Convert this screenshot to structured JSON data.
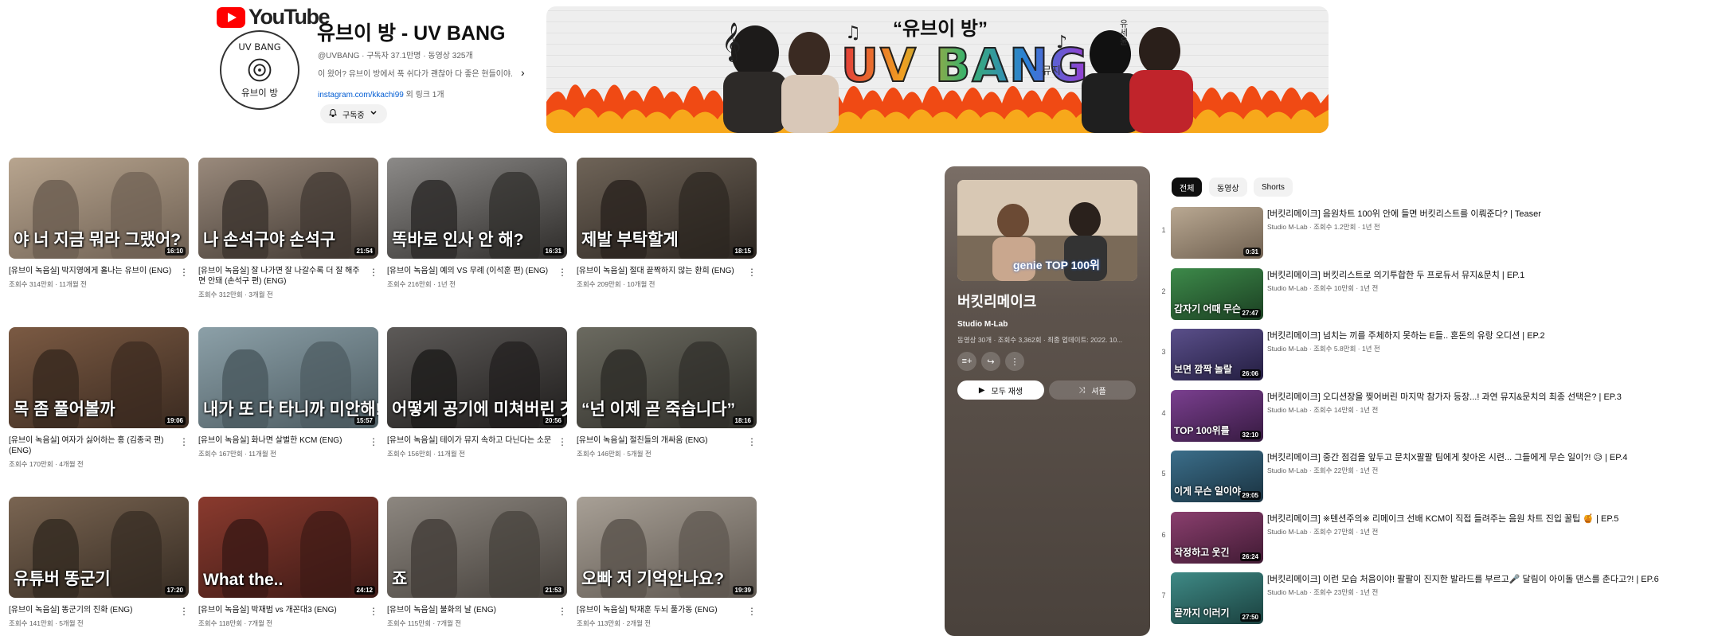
{
  "logo": {
    "wordmark": "YouTube"
  },
  "channel": {
    "avatar_text": "UV BANG 유브이 방",
    "title": "유브이 방 - UV BANG",
    "meta": "@UVBANG · 구독자 37.1만명 · 동영상 325개",
    "description": "이 왔어? 유브이 방에서 푹 쉬다가 괜찮아 다 좋은 현들이야.",
    "link_text": "instagram.com/kkachi99",
    "link_extra": " 외 링크 1개",
    "subscribe_label": "구독중"
  },
  "banner": {
    "subtitle": "“유브이 방”",
    "title": "UV BANG",
    "tag1": "뮤지",
    "tag2": "유세윤"
  },
  "videos": [
    {
      "caption": "야 너 지금 뭐라 그랬어?",
      "duration": "16:10",
      "title": "[유브이 녹음실] 박지영에게 홀나는 유브이 (ENG)",
      "meta": "조회수 314만회 · 11개월 전",
      "bg": "#b8a58f",
      "bg2": "#6d5f52"
    },
    {
      "caption": "나 손석구야 손석구",
      "duration": "21:54",
      "title": "[유브이 녹음실] 잘 나가면 잘 나갈수록 더 잘 해주면 안돼 (손석구 편) (ENG)",
      "meta": "조회수 312만회 · 3개월 전",
      "bg": "#9a8a7c",
      "bg2": "#3e3630"
    },
    {
      "caption": "똑바로 인사 안 해?",
      "duration": "16:31",
      "title": "[유브이 녹음실] 예의 VS 무례 (이석훈 편) (ENG)",
      "meta": "조회수 216만회 · 1년 전",
      "bg": "#8c8a88",
      "bg2": "#2e2c2a"
    },
    {
      "caption": "제발 부탁할게",
      "duration": "18:15",
      "title": "[유브이 녹음실] 절대 끝짝하지 않는 환희 (ENG)",
      "meta": "조회수 209만회 · 10개월 전",
      "bg": "#6f6458",
      "bg2": "#2b2520"
    },
    {
      "caption": "목 좀 풀어볼까",
      "duration": "19:06",
      "title": "[유브이 녹음실] 여자가 싫어하는 홍 (김종국 편) (ENG)",
      "meta": "조회수 170만회 · 4개월 전",
      "bg": "#7b5a43",
      "bg2": "#3a2a20"
    },
    {
      "caption": "내가 또 다 타니까 미안해!",
      "duration": "15:57",
      "title": "[유브이 녹음실] 화나면 살벌한 KCM (ENG)",
      "meta": "조회수 167만회 · 11개월 전",
      "bg": "#8ca0a8",
      "bg2": "#4b5a60"
    },
    {
      "caption": "어떻게 공기에 미쳐버린 것 같아",
      "duration": "20:56",
      "title": "[유브이 녹음실] 테이가 뮤지 속하고 다닌다는 소문",
      "meta": "조회수 156만회 · 11개월 전",
      "bg": "#5d5a58",
      "bg2": "#1f1d1c"
    },
    {
      "caption": "“넌 이제 곧 죽습니다”",
      "duration": "18:16",
      "title": "[유브이 녹음실] 절친들의 개싸움 (ENG)",
      "meta": "조회수 146만회 · 5개월 전",
      "bg": "#6b6a60",
      "bg2": "#2f2e29"
    },
    {
      "caption": "유튜버 똥군기",
      "duration": "17:20",
      "title": "[유브이 녹음실] 똥군기의 진화 (ENG)",
      "meta": "조회수 141만회 · 5개월 전",
      "bg": "#7a6552",
      "bg2": "#352b22"
    },
    {
      "caption": "What the..",
      "duration": "24:12",
      "title": "[유브이 녹음실] 박재범 vs 개꼰대3 (ENG)",
      "meta": "조회수 118만회 · 7개월 전",
      "bg": "#8a3a2e",
      "bg2": "#3d1a16"
    },
    {
      "caption": "죠",
      "duration": "21:53",
      "title": "[유브이 녹음실] 불화의 날 (ENG)",
      "meta": "조회수 115만회 · 7개월 전",
      "bg": "#8d8780",
      "bg2": "#45403b"
    },
    {
      "caption": "오빠 저 기억안나요?",
      "duration": "19:39",
      "title": "[유브이 녹음실] 탁재훈 두뇌 풀가동 (ENG)",
      "meta": "조회수 113만회 · 2개월 전",
      "bg": "#a8a096",
      "bg2": "#5c554e"
    }
  ],
  "playlist": {
    "thumb_caption": "genie TOP 100위",
    "title": "버킷리메이크",
    "owner": "Studio M-Lab",
    "stats": "동영상 30개 · 조회수 3,362회 · 최종 업데이트: 2022. 10...",
    "play_all": "모두 재생",
    "shuffle": "셔플"
  },
  "chips": [
    "전체",
    "동영상",
    "Shorts"
  ],
  "playlist_items": [
    {
      "index": "1",
      "title": "[버킷리메이크] 음원차트 100위 안에 들면 버킷리스트를 이뤄준다? | Teaser",
      "meta": "Studio M-Lab · 조회수 1.2만회 · 1년 전",
      "duration": "0:31",
      "caption": "",
      "bg": "#b9a892",
      "bg2": "#6f6050"
    },
    {
      "index": "2",
      "title": "[버킷리메이크] 버킷리스트로 의기투합한 두 프로듀서 뮤지&문치 | EP.1",
      "meta": "Studio M-Lab · 조회수 10만회 · 1년 전",
      "duration": "27:47",
      "caption": "갑자기 어때 무슨",
      "bg": "#3d8a4a",
      "bg2": "#1b3f22"
    },
    {
      "index": "3",
      "title": "[버킷리메이크] 넘치는 끼를 주체하지 못하는 E들.. 혼돈의 유랑 오디션 | EP.2",
      "meta": "Studio M-Lab · 조회수 5.8만회 · 1년 전",
      "duration": "26:06",
      "caption": "보면 깜짝 놀랄",
      "bg": "#5a4f8a",
      "bg2": "#231d40"
    },
    {
      "index": "4",
      "title": "[버킷리메이크] 오디션장을 찢어버린 마지막 참가자 등장...! 과연 뮤지&문치의 최종 선택은? | EP.3",
      "meta": "Studio M-Lab · 조회수 14만회 · 1년 전",
      "duration": "32:10",
      "caption": "TOP 100위를",
      "bg": "#7a3f8f",
      "bg2": "#361a40"
    },
    {
      "index": "5",
      "title": "[버킷리메이크] 중간 점검을 앞두고 문치X팔팔 팀에게 찾아온 시련... 그들에게 무슨 일이?! 😥 | EP.4",
      "meta": "Studio M-Lab · 조회수 22만회 · 1년 전",
      "duration": "29:05",
      "caption": "이게 무슨 일이야",
      "bg": "#3b6e8a",
      "bg2": "#1a3240"
    },
    {
      "index": "6",
      "title": "[버킷리메이크] ※텐션주의※ 리메이크 선배 KCM이 직접 들려주는 음원 차트 진입 꿀팁 🍯 | EP.5",
      "meta": "Studio M-Lab · 조회수 27만회 · 1년 전",
      "duration": "26:24",
      "caption": "작정하고 웃긴",
      "bg": "#8a3f6e",
      "bg2": "#401a33"
    },
    {
      "index": "7",
      "title": "[버킷리메이크] 이런 모습 처음이야! 팔팔이 진지한 발라드를 부르고🎤 달림이 아이돌 댄스를 춘다고?! | EP.6",
      "meta": "Studio M-Lab · 조회수 23만회 · 1년 전",
      "duration": "27:50",
      "caption": "끝까지 이러기",
      "bg": "#3f8a86",
      "bg2": "#1a403e"
    }
  ]
}
